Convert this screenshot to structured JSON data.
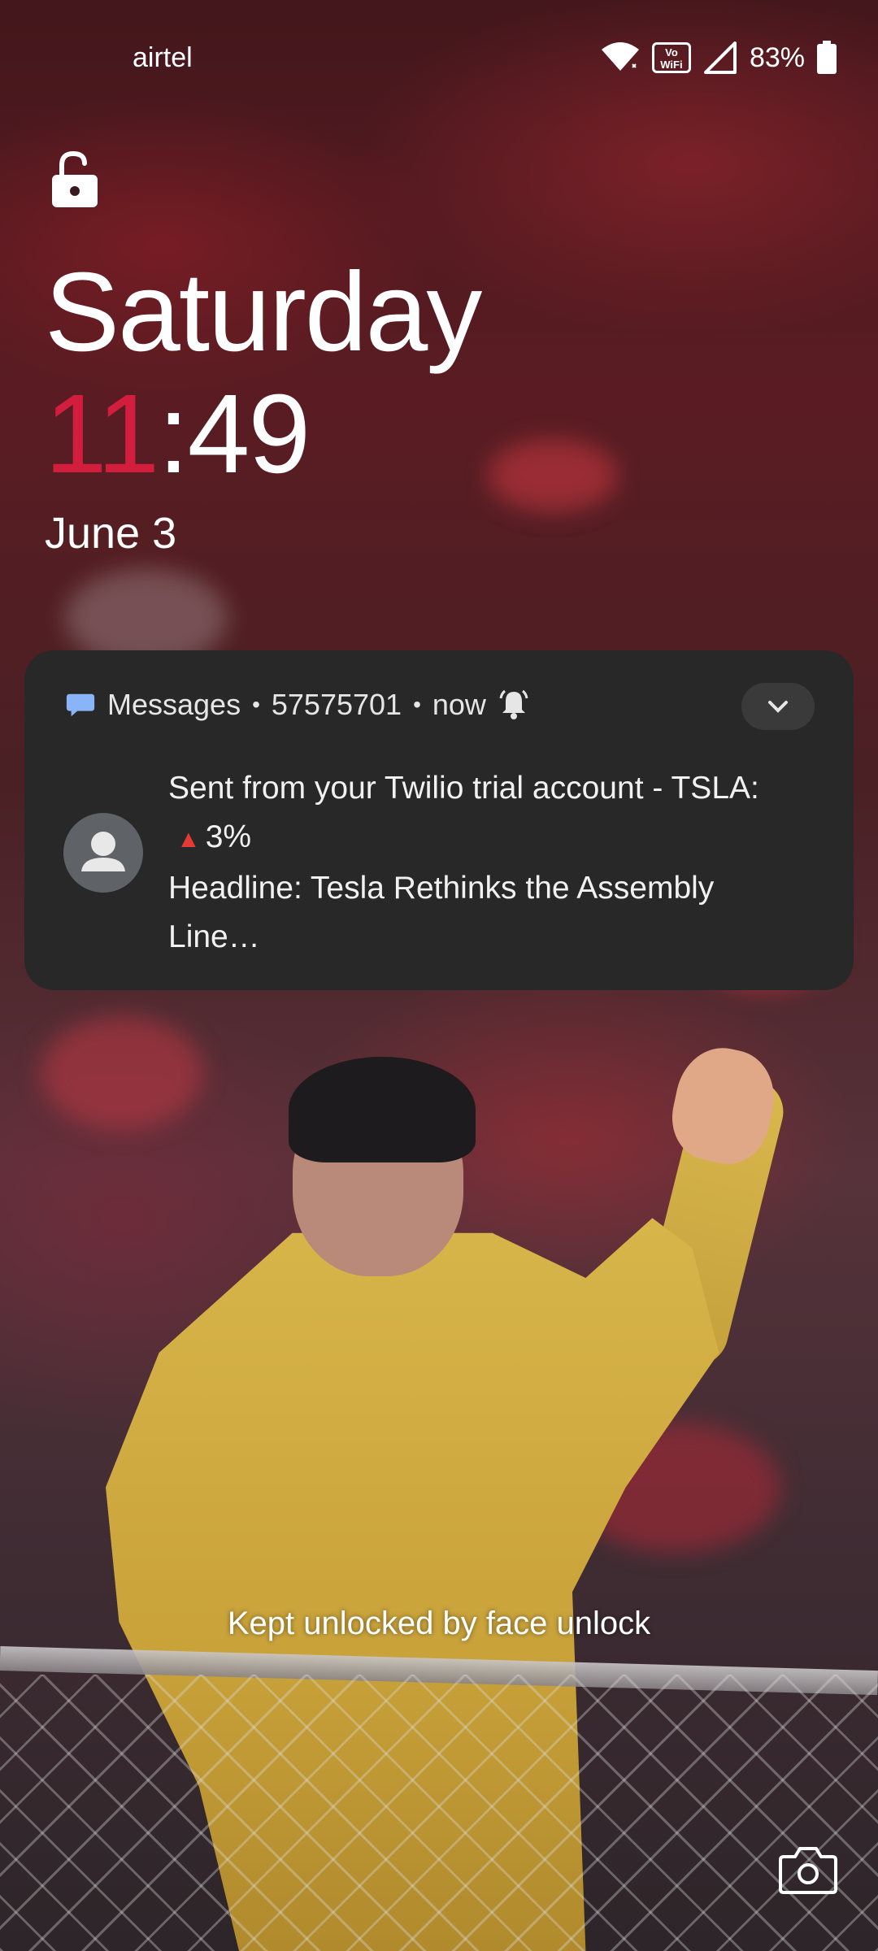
{
  "status_bar": {
    "carrier": "airtel",
    "vowifi_line1": "Vo",
    "vowifi_line2": "WiFi",
    "battery": "83%",
    "icons": [
      "wifi-icon",
      "vowifi-icon",
      "signal-icon",
      "battery-icon"
    ]
  },
  "lock": {
    "icon": "unlock-icon"
  },
  "clock": {
    "day": "Saturday",
    "hour": "11",
    "separator": ":",
    "minute": "49",
    "date": "June 3",
    "hour_color": "#d21e3c"
  },
  "notification": {
    "app": "Messages",
    "sep1": "•",
    "sender": "57575701",
    "sep2": "•",
    "time": "now",
    "line1": "Sent from your Twilio trial account - TSLA:",
    "trend_icon": "▲",
    "change": "3%",
    "line3": "Headline: Tesla Rethinks the Assembly",
    "line4": "Line…",
    "icons": [
      "messages-icon",
      "alert-bell-icon",
      "chevron-down-icon",
      "avatar-icon"
    ]
  },
  "bottom": {
    "face_unlock_text": "Kept unlocked by face unlock",
    "camera_icon": "camera-icon"
  }
}
